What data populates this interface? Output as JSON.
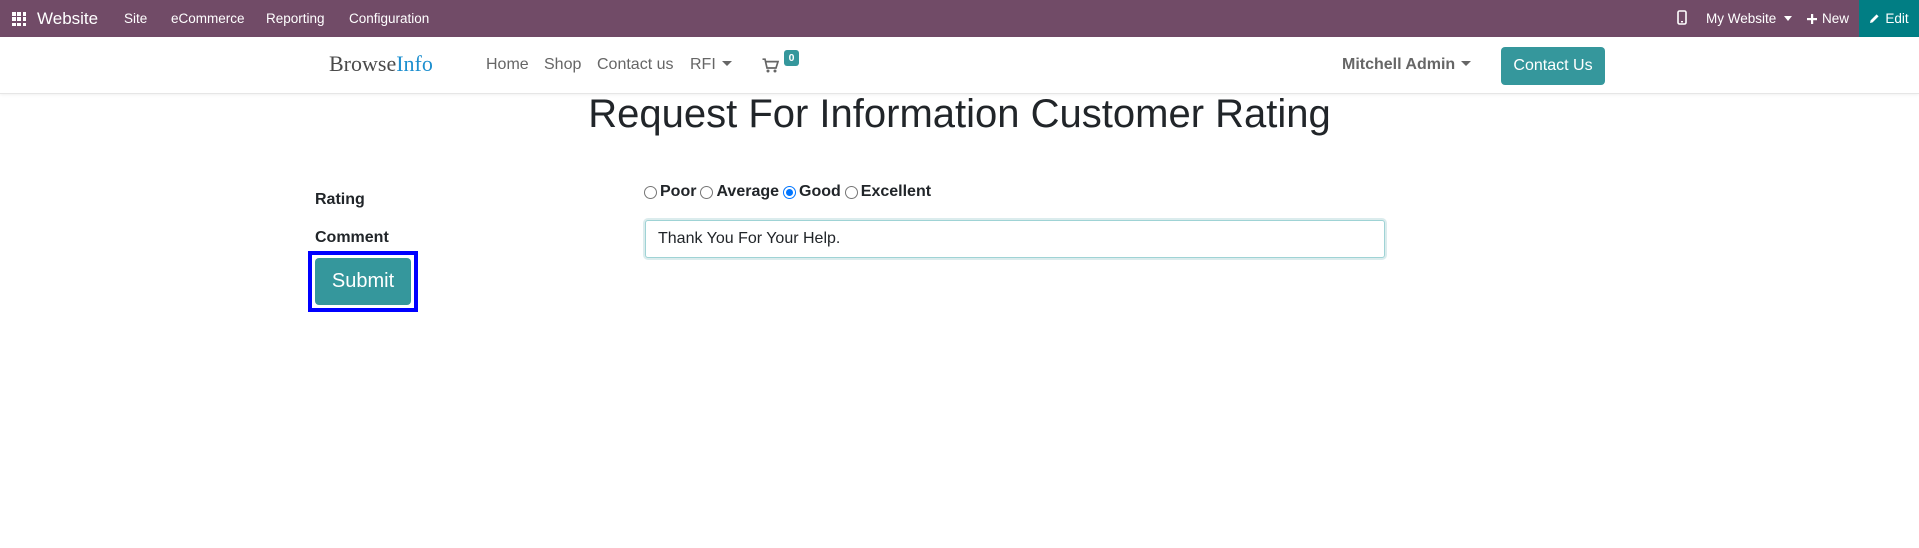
{
  "topbar": {
    "app_name": "Website",
    "menus": [
      "Site",
      "eCommerce",
      "Reporting",
      "Configuration"
    ],
    "website_switcher": "My Website",
    "new_label": "New",
    "edit_label": "Edit",
    "bg_color": "#714B67",
    "edit_bg_color": "#017E84"
  },
  "header": {
    "logo_part1": "Browse",
    "logo_part2": "Info",
    "nav": [
      "Home",
      "Shop",
      "Contact us",
      "RFI"
    ],
    "cart_count": "0",
    "user_name": "Mitchell Admin",
    "contact_button": "Contact Us",
    "accent_color": "#35979C"
  },
  "page": {
    "title": "Request For Information Customer Rating",
    "rating_label": "Rating",
    "comment_label": "Comment",
    "rating_options": [
      "Poor",
      "Average",
      "Good",
      "Excellent"
    ],
    "rating_selected": "Good",
    "comment_value": "Thank You For Your Help.",
    "submit_label": "Submit"
  }
}
